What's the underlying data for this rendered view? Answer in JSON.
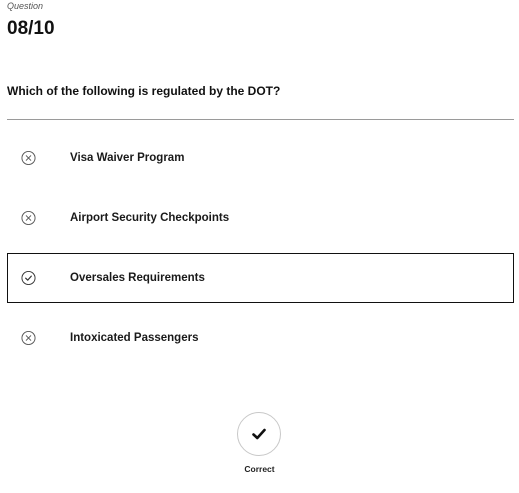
{
  "question": {
    "label": "Question",
    "counter": "08/10",
    "text": "Which of the following is regulated by the DOT?"
  },
  "options": [
    {
      "label": "Visa Waiver Program",
      "status": "incorrect",
      "icon": "x-circle-icon"
    },
    {
      "label": "Airport Security Checkpoints",
      "status": "incorrect",
      "icon": "x-circle-icon"
    },
    {
      "label": "Oversales Requirements",
      "status": "correct-selected",
      "icon": "check-circle-icon"
    },
    {
      "label": "Intoxicated Passengers",
      "status": "incorrect",
      "icon": "x-circle-icon"
    }
  ],
  "result": {
    "label": "Correct",
    "icon": "checkmark-icon"
  },
  "colors": {
    "text": "#1a1a1a",
    "divider": "#9a9a9a",
    "selected_border": "#111111"
  }
}
